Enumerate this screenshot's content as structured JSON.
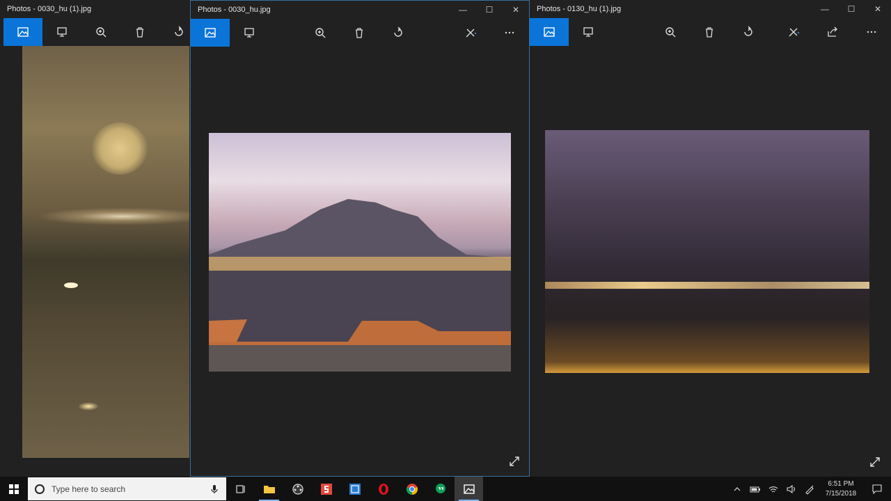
{
  "windows": [
    {
      "title": "Photos - 0030_hu (1).jpg"
    },
    {
      "title": "Photos - 0030_hu.jpg"
    },
    {
      "title": "Photos - 0130_hu (1).jpg"
    }
  ],
  "toolbar_icons": [
    "view-image-icon",
    "slideshow-icon",
    "zoom-icon",
    "delete-icon",
    "rotate-icon",
    "edit-icon",
    "share-icon",
    "more-icon"
  ],
  "window_controls": {
    "minimize": "—",
    "maximize": "☐",
    "close": "✕"
  },
  "taskbar": {
    "search_placeholder": "Type here to search",
    "time": "6:51 PM",
    "date": "7/15/2018"
  },
  "colors": {
    "accent": "#0a74d9",
    "window_bg": "#212121",
    "taskbar_bg": "#111111"
  }
}
